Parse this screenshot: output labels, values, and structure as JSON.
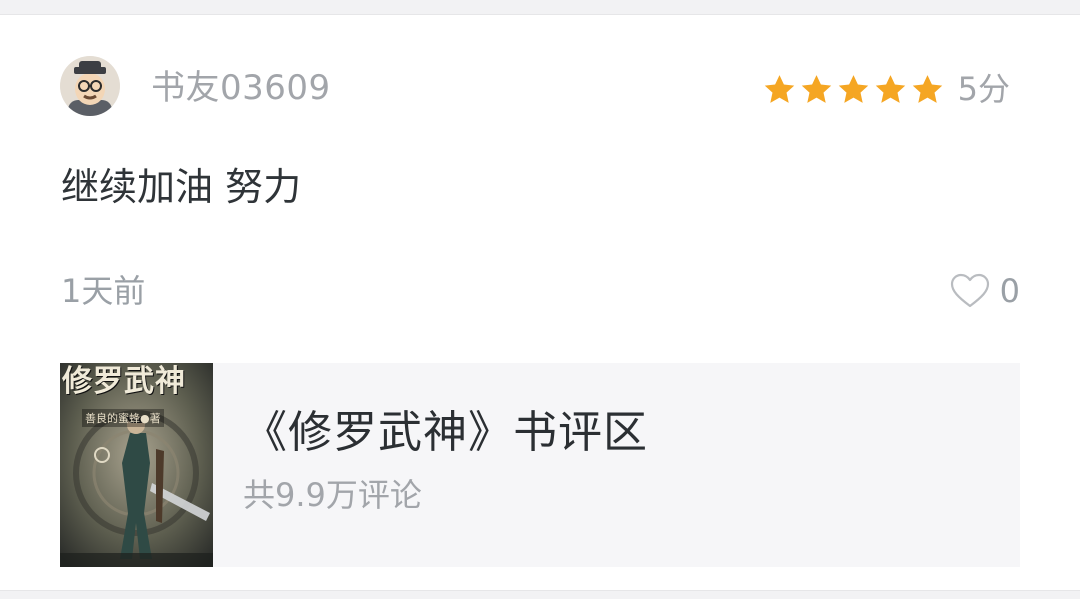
{
  "review": {
    "username": "书友03609",
    "rating_stars": 5,
    "rating_text": "5分",
    "content": "继续加油 努力",
    "time": "1天前",
    "like_count": "0"
  },
  "book": {
    "title": "《修罗武神》书评区",
    "comment_count": "共9.9万评论",
    "cover_title": "修罗武神",
    "cover_author": "善良的蜜蜂●著"
  },
  "colors": {
    "star": "#f5a623",
    "secondary_text": "#a2a5aa",
    "primary_text": "#2f3438",
    "card_bg": "#f6f6f8"
  },
  "icons": {
    "avatar": "user-avatar-icon",
    "star": "star-icon",
    "like": "heart-outline-icon"
  }
}
